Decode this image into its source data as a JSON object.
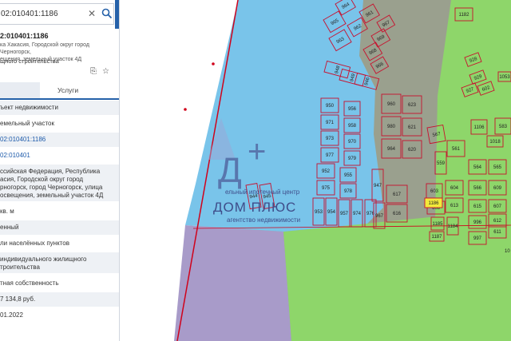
{
  "search": {
    "value": "02:010401:1186"
  },
  "object": {
    "title": "2:010401:1186",
    "address": "ка Хакасия, Городской округ город Черногорск,\nещения, земельный участок 4Д",
    "type": "щного строительства"
  },
  "tabs": {
    "services": "Услуги"
  },
  "rows": [
    {
      "text": "ъект недвижимости"
    },
    {
      "text": "емельный участок"
    },
    {
      "text": "02:010401:1186",
      "link": true
    },
    {
      "text": "02:010401",
      "link": true
    },
    {
      "text": "ссийская Федерация, Республика\nасия, Городской округ город\nрногорск, город Черногорск, улица\nосвещения, земельный участок 4Д"
    },
    {
      "text": "кв. м"
    },
    {
      "text": "енный"
    },
    {
      "text": "ли населённых пунктов"
    },
    {
      "text": "индивидуального жилищного\nтроительства"
    },
    {
      "text": "тная собственность"
    },
    {
      "text": "7 134,8 руб."
    },
    {
      "text": "01.2022"
    }
  ],
  "watermark": {
    "line1": "ельный ипотечный центр",
    "brand": "ДОМ ПЛЮС",
    "line2": "агентство недвижимости"
  },
  "plots": {
    "pond": [
      "965",
      "964",
      "963",
      "962",
      "961",
      "969",
      "968",
      "967",
      "966",
      "948",
      "949",
      "946",
      "950",
      "956",
      "971",
      "958",
      "973",
      "970",
      "977",
      "979",
      "952",
      "955",
      "975",
      "978",
      "944",
      "945",
      "953",
      "954",
      "957",
      "974",
      "976"
    ],
    "middle": [
      "960",
      "623",
      "980",
      "621",
      "964",
      "620",
      "947",
      "617",
      "616",
      "967"
    ],
    "right": [
      "1182",
      "928",
      "929",
      "927",
      "602",
      "1053",
      "559",
      "567",
      "561",
      "1018",
      "564",
      "565",
      "604",
      "566",
      "609",
      "603",
      "613",
      "615",
      "607",
      "608",
      "612",
      "611",
      "996",
      "997",
      "1187",
      "1184",
      "1186",
      "1185",
      "583",
      "1106"
    ],
    "selected": "1186",
    "edge_label": "10"
  },
  "colors": {
    "pond": "#79c4ea",
    "green": "#8ed66a",
    "purple": "#a89bc9",
    "plot_border": "#c8102e",
    "selected": "#f2ea3a"
  }
}
